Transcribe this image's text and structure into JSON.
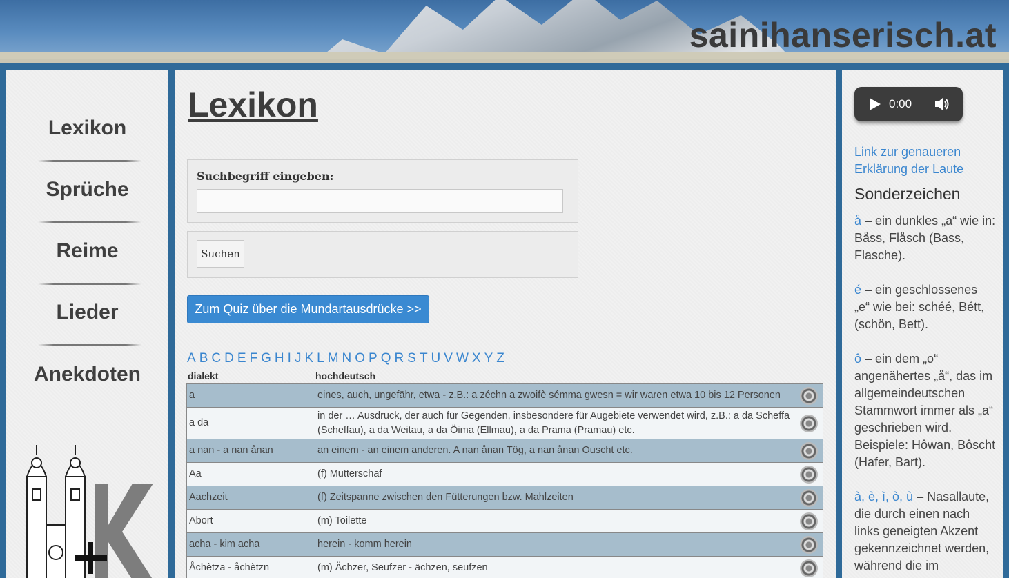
{
  "header": {
    "site_title": "sainihanserisch.at"
  },
  "nav": [
    {
      "label": "Lexikon"
    },
    {
      "label": "Sprüche"
    },
    {
      "label": "Reime"
    },
    {
      "label": "Lieder"
    },
    {
      "label": "Anekdoten"
    }
  ],
  "main": {
    "title": "Lexikon",
    "search_label": "Suchbegriff eingeben:",
    "search_value": "",
    "search_button": "Suchen",
    "quiz_button": "Zum Quiz über die Mundartausdrücke >>",
    "alphabet": [
      "A",
      "B",
      "C",
      "D",
      "E",
      "F",
      "G",
      "H",
      "I",
      "J",
      "K",
      "L",
      "M",
      "N",
      "O",
      "P",
      "Q",
      "R",
      "S",
      "T",
      "U",
      "V",
      "W",
      "X",
      "Y",
      "Z"
    ],
    "col_dialekt": "dialekt",
    "col_hochdeutsch": "hochdeutsch",
    "rows": [
      {
        "dialekt": "a",
        "hochdeutsch": "eines, auch, ungefähr, etwa - z.B.: a zéchn a zwoifè sémma gwesn = wir waren etwa 10 bis 12 Personen"
      },
      {
        "dialekt": "a da",
        "hochdeutsch": "in der … Ausdruck, der auch für Gegenden, insbesondere für Augebiete verwendet wird, z.B.: a da Scheffa (Scheffau), a da Weitau, a da Öima (Ellmau), a da Prama (Pramau) etc."
      },
      {
        "dialekt": "a nan - a nan ånan",
        "hochdeutsch": "an einem - an einem anderen. A nan ånan Tôg, a nan ånan Ouscht etc."
      },
      {
        "dialekt": "Aa",
        "hochdeutsch": "(f) Mutterschaf"
      },
      {
        "dialekt": "Aachzeit",
        "hochdeutsch": "(f) Zeitspanne zwischen den Fütterungen bzw. Mahlzeiten"
      },
      {
        "dialekt": "Abort",
        "hochdeutsch": "(m) Toilette"
      },
      {
        "dialekt": "acha - kim acha",
        "hochdeutsch": "herein - komm herein"
      },
      {
        "dialekt": "Åchètza - åchètzn",
        "hochdeutsch": "(m) Ächzer, Seufzer - ächzen, seufzen"
      }
    ]
  },
  "sidebar_right": {
    "audio_time": "0:00",
    "sounds_link": "Link zur genaueren Erklärung der Laute",
    "special_heading": "Sonderzeichen",
    "entries": [
      {
        "symbol": "å",
        "text": " – ein dunkles „a“ wie in: Båss, Flåsch (Bass, Flasche)."
      },
      {
        "symbol": "é",
        "text": " – ein geschlossenes „e“ wie bei: schéé, Bétt, (schön, Bett)."
      },
      {
        "symbol": "ô",
        "text": " – ein dem „o“ angenähertes „å“, das im allgemeindeutschen Stammwort immer als „a“ geschrieben wird. Beispiele: Hôwan, Bôscht (Hafer, Bart)."
      },
      {
        "symbol": "à, è, ì, ò, ù",
        "text": " – Nasallaute, die durch einen nach links geneigten Akzent gekennzeichnet werden, während die im"
      }
    ]
  },
  "colors": {
    "accent_blue": "#3a8ad2",
    "row_odd": "#a6bdcc",
    "frame": "#2f6a99"
  }
}
